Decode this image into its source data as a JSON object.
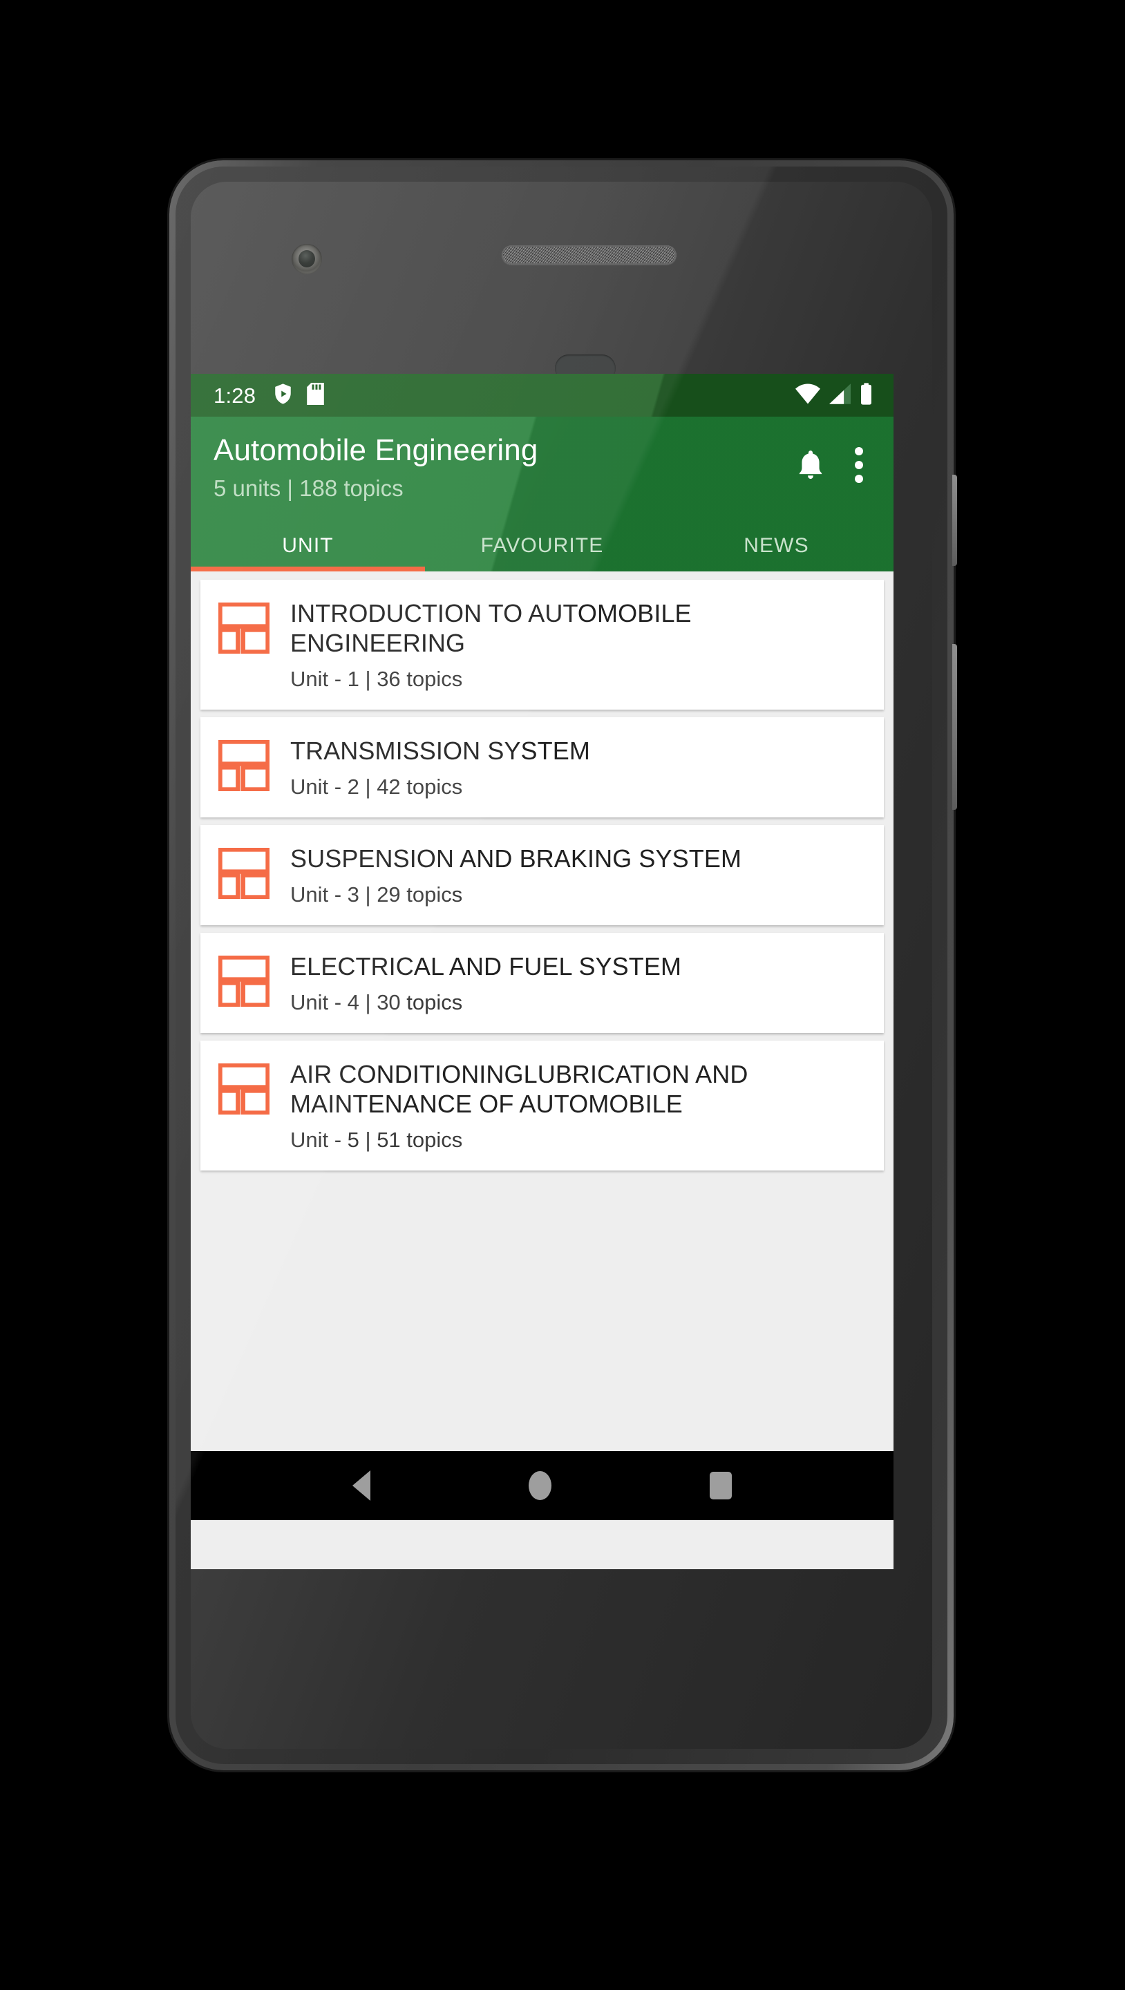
{
  "colors": {
    "status_bar_bg": "#1b5e20",
    "app_bar_bg": "#1e7c33",
    "accent_orange": "#f4623a",
    "content_bg": "#eeeeee",
    "card_bg": "#ffffff",
    "nav_bar_bg": "#000000"
  },
  "status_bar": {
    "time": "1:28",
    "icons_left": [
      "play-protect-shield-icon",
      "sd-card-icon"
    ],
    "icons_right": [
      "wifi-icon",
      "cellular-signal-icon",
      "battery-icon"
    ]
  },
  "app_bar": {
    "title": "Automobile Engineering",
    "subtitle": "5 units | 188 topics",
    "actions": [
      {
        "name": "notifications-bell-icon",
        "label": ""
      },
      {
        "name": "overflow-menu-icon",
        "label": ""
      }
    ]
  },
  "tabs": {
    "items": [
      {
        "label": "UNIT",
        "active": true
      },
      {
        "label": "FAVOURITE",
        "active": false
      },
      {
        "label": "NEWS",
        "active": false
      }
    ]
  },
  "units": [
    {
      "title": "INTRODUCTION TO AUTOMOBILE ENGINEERING",
      "subtitle": "Unit - 1 | 36 topics",
      "icon": "dashboard-layout-icon"
    },
    {
      "title": "TRANSMISSION SYSTEM",
      "subtitle": "Unit - 2 | 42 topics",
      "icon": "dashboard-layout-icon"
    },
    {
      "title": "SUSPENSION AND BRAKING SYSTEM",
      "subtitle": "Unit - 3 | 29 topics",
      "icon": "dashboard-layout-icon"
    },
    {
      "title": "ELECTRICAL AND FUEL SYSTEM",
      "subtitle": "Unit - 4 | 30 topics",
      "icon": "dashboard-layout-icon"
    },
    {
      "title": "AIR CONDITIONINGLUBRICATION AND MAINTENANCE OF AUTOMOBILE",
      "subtitle": "Unit - 5 | 51 topics",
      "icon": "dashboard-layout-icon"
    }
  ],
  "nav_bar": {
    "buttons": [
      {
        "name": "android-back-button"
      },
      {
        "name": "android-home-button"
      },
      {
        "name": "android-recents-button"
      }
    ]
  }
}
